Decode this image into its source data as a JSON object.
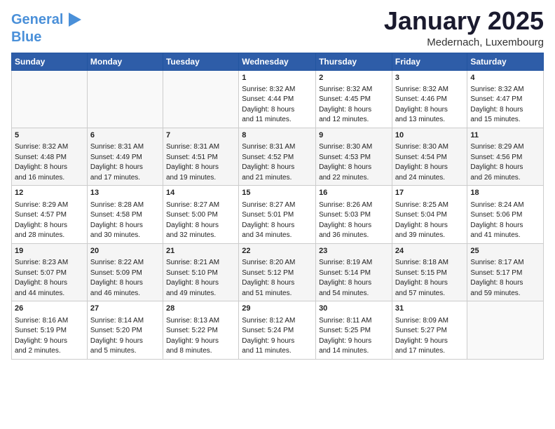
{
  "header": {
    "logo_line1": "General",
    "logo_line2": "Blue",
    "month": "January 2025",
    "location": "Medernach, Luxembourg"
  },
  "weekdays": [
    "Sunday",
    "Monday",
    "Tuesday",
    "Wednesday",
    "Thursday",
    "Friday",
    "Saturday"
  ],
  "weeks": [
    [
      {
        "day": "",
        "info": ""
      },
      {
        "day": "",
        "info": ""
      },
      {
        "day": "",
        "info": ""
      },
      {
        "day": "1",
        "info": "Sunrise: 8:32 AM\nSunset: 4:44 PM\nDaylight: 8 hours\nand 11 minutes."
      },
      {
        "day": "2",
        "info": "Sunrise: 8:32 AM\nSunset: 4:45 PM\nDaylight: 8 hours\nand 12 minutes."
      },
      {
        "day": "3",
        "info": "Sunrise: 8:32 AM\nSunset: 4:46 PM\nDaylight: 8 hours\nand 13 minutes."
      },
      {
        "day": "4",
        "info": "Sunrise: 8:32 AM\nSunset: 4:47 PM\nDaylight: 8 hours\nand 15 minutes."
      }
    ],
    [
      {
        "day": "5",
        "info": "Sunrise: 8:32 AM\nSunset: 4:48 PM\nDaylight: 8 hours\nand 16 minutes."
      },
      {
        "day": "6",
        "info": "Sunrise: 8:31 AM\nSunset: 4:49 PM\nDaylight: 8 hours\nand 17 minutes."
      },
      {
        "day": "7",
        "info": "Sunrise: 8:31 AM\nSunset: 4:51 PM\nDaylight: 8 hours\nand 19 minutes."
      },
      {
        "day": "8",
        "info": "Sunrise: 8:31 AM\nSunset: 4:52 PM\nDaylight: 8 hours\nand 21 minutes."
      },
      {
        "day": "9",
        "info": "Sunrise: 8:30 AM\nSunset: 4:53 PM\nDaylight: 8 hours\nand 22 minutes."
      },
      {
        "day": "10",
        "info": "Sunrise: 8:30 AM\nSunset: 4:54 PM\nDaylight: 8 hours\nand 24 minutes."
      },
      {
        "day": "11",
        "info": "Sunrise: 8:29 AM\nSunset: 4:56 PM\nDaylight: 8 hours\nand 26 minutes."
      }
    ],
    [
      {
        "day": "12",
        "info": "Sunrise: 8:29 AM\nSunset: 4:57 PM\nDaylight: 8 hours\nand 28 minutes."
      },
      {
        "day": "13",
        "info": "Sunrise: 8:28 AM\nSunset: 4:58 PM\nDaylight: 8 hours\nand 30 minutes."
      },
      {
        "day": "14",
        "info": "Sunrise: 8:27 AM\nSunset: 5:00 PM\nDaylight: 8 hours\nand 32 minutes."
      },
      {
        "day": "15",
        "info": "Sunrise: 8:27 AM\nSunset: 5:01 PM\nDaylight: 8 hours\nand 34 minutes."
      },
      {
        "day": "16",
        "info": "Sunrise: 8:26 AM\nSunset: 5:03 PM\nDaylight: 8 hours\nand 36 minutes."
      },
      {
        "day": "17",
        "info": "Sunrise: 8:25 AM\nSunset: 5:04 PM\nDaylight: 8 hours\nand 39 minutes."
      },
      {
        "day": "18",
        "info": "Sunrise: 8:24 AM\nSunset: 5:06 PM\nDaylight: 8 hours\nand 41 minutes."
      }
    ],
    [
      {
        "day": "19",
        "info": "Sunrise: 8:23 AM\nSunset: 5:07 PM\nDaylight: 8 hours\nand 44 minutes."
      },
      {
        "day": "20",
        "info": "Sunrise: 8:22 AM\nSunset: 5:09 PM\nDaylight: 8 hours\nand 46 minutes."
      },
      {
        "day": "21",
        "info": "Sunrise: 8:21 AM\nSunset: 5:10 PM\nDaylight: 8 hours\nand 49 minutes."
      },
      {
        "day": "22",
        "info": "Sunrise: 8:20 AM\nSunset: 5:12 PM\nDaylight: 8 hours\nand 51 minutes."
      },
      {
        "day": "23",
        "info": "Sunrise: 8:19 AM\nSunset: 5:14 PM\nDaylight: 8 hours\nand 54 minutes."
      },
      {
        "day": "24",
        "info": "Sunrise: 8:18 AM\nSunset: 5:15 PM\nDaylight: 8 hours\nand 57 minutes."
      },
      {
        "day": "25",
        "info": "Sunrise: 8:17 AM\nSunset: 5:17 PM\nDaylight: 8 hours\nand 59 minutes."
      }
    ],
    [
      {
        "day": "26",
        "info": "Sunrise: 8:16 AM\nSunset: 5:19 PM\nDaylight: 9 hours\nand 2 minutes."
      },
      {
        "day": "27",
        "info": "Sunrise: 8:14 AM\nSunset: 5:20 PM\nDaylight: 9 hours\nand 5 minutes."
      },
      {
        "day": "28",
        "info": "Sunrise: 8:13 AM\nSunset: 5:22 PM\nDaylight: 9 hours\nand 8 minutes."
      },
      {
        "day": "29",
        "info": "Sunrise: 8:12 AM\nSunset: 5:24 PM\nDaylight: 9 hours\nand 11 minutes."
      },
      {
        "day": "30",
        "info": "Sunrise: 8:11 AM\nSunset: 5:25 PM\nDaylight: 9 hours\nand 14 minutes."
      },
      {
        "day": "31",
        "info": "Sunrise: 8:09 AM\nSunset: 5:27 PM\nDaylight: 9 hours\nand 17 minutes."
      },
      {
        "day": "",
        "info": ""
      }
    ]
  ]
}
